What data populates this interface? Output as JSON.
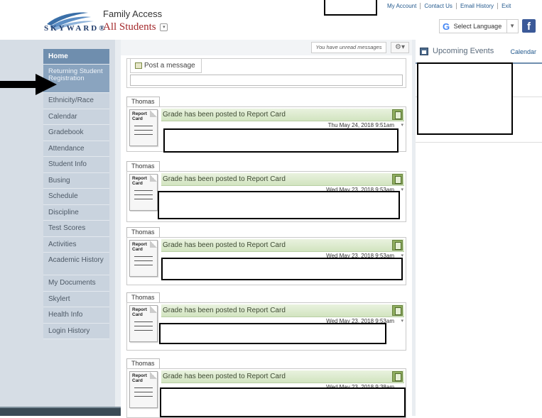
{
  "header": {
    "logo_text": "SKYWARD®",
    "family_access": "Family Access",
    "all_students": "All Students",
    "dropdown_glyph": "▾",
    "links": [
      "My Account",
      "Contact Us",
      "Email History",
      "Exit"
    ],
    "language": {
      "icon": "G",
      "label": "Select Language",
      "arrow": "▼"
    },
    "facebook": "f"
  },
  "nav": {
    "items": [
      "Home",
      "Returning Student Registration",
      "Ethnicity/Race",
      "Calendar",
      "Gradebook",
      "Attendance",
      "Student Info",
      "Busing",
      "Schedule",
      "Discipline",
      "Test Scores",
      "Activities",
      "Academic History",
      "My Documents",
      "Skylert",
      "Health Info",
      "Login History"
    ]
  },
  "feed": {
    "unread": "You have unread messages",
    "gear": "⚙▾",
    "post_label": "Post a message",
    "cards": [
      {
        "student": "Thomas",
        "title": "Grade has been posted to Report Card",
        "date": "Thu May 24, 2018 9:51am",
        "icon_label": "Report Card"
      },
      {
        "student": "Thomas",
        "title": "Grade has been posted to Report Card",
        "date": "Wed May 23, 2018 9:53am",
        "icon_label": "Report Card"
      },
      {
        "student": "Thomas",
        "title": "Grade has been posted to Report Card",
        "date": "Wed May 23, 2018 9:53am",
        "icon_label": "Report Card"
      },
      {
        "student": "Thomas",
        "title": "Grade has been posted to Report Card",
        "date": "Wed May 23, 2018 9:53am",
        "icon_label": "Report Card"
      },
      {
        "student": "Thomas",
        "title": "Grade has been posted to Report Card",
        "date": "Wed May 23, 2018 9:38am",
        "icon_label": "Report Card"
      }
    ]
  },
  "right": {
    "title": "Upcoming Events",
    "calendar_link": "Calendar"
  },
  "colors": {
    "nav_home": "#6f8eae",
    "nav_item": "#c9d3de",
    "brand_red": "#a3282b",
    "link_blue": "#245a8e",
    "card_green": "#d2e4c0"
  }
}
